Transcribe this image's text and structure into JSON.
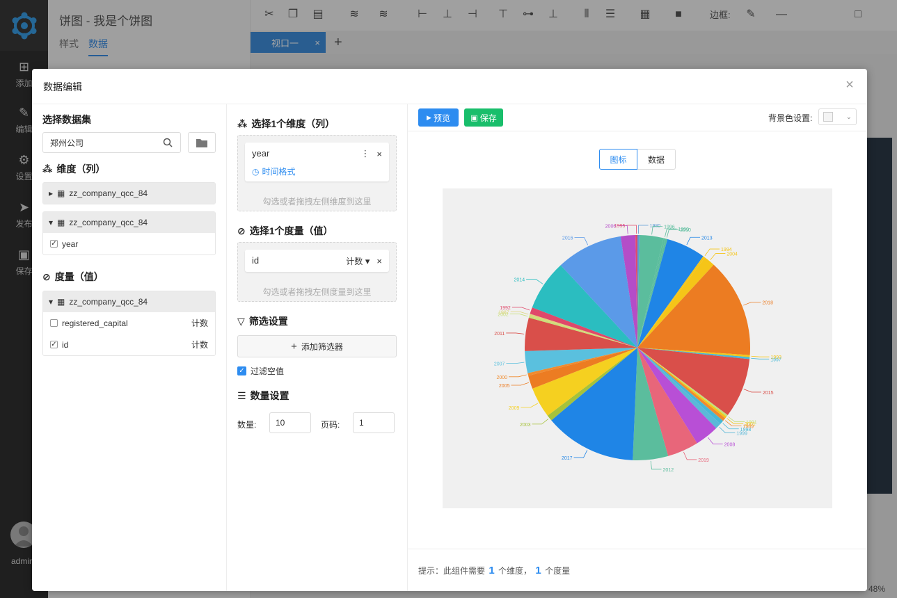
{
  "app": {
    "title": "饼图 - 我是个饼图",
    "side_tabs": [
      "样式",
      "数据"
    ],
    "nav": [
      "添加",
      "编辑",
      "设置",
      "发布",
      "保存"
    ],
    "user": "admin",
    "viewport_tab": "视口一",
    "border_label": "边框:",
    "zoom": "48%"
  },
  "dialog": {
    "title": "数据编辑",
    "dataset": {
      "title": "选择数据集",
      "search_value": "郑州公司",
      "dimensions_title": "维度（列）",
      "dimension_groups": [
        {
          "table": "zz_company_qcc_84",
          "expanded": false,
          "fields": []
        },
        {
          "table": "zz_company_qcc_84",
          "expanded": true,
          "fields": [
            {
              "name": "year",
              "checked": true
            }
          ]
        }
      ],
      "measures_title": "度量（值）",
      "measure_group": {
        "table": "zz_company_qcc_84",
        "fields": [
          {
            "name": "registered_capital",
            "checked": false,
            "agg": "计数"
          },
          {
            "name": "id",
            "checked": true,
            "agg": "计数"
          }
        ]
      }
    },
    "config": {
      "dim_title": "选择1个维度（列）",
      "dim_chip": {
        "name": "year",
        "time_format": "时间格式"
      },
      "dim_hint": "勾选或者拖拽左侧维度到这里",
      "measure_title": "选择1个度量（值）",
      "measure_chip": {
        "name": "id",
        "agg": "计数"
      },
      "measure_hint": "勾选或者拖拽左侧度量到这里",
      "filter_title": "筛选设置",
      "add_filter": "添加筛选器",
      "filter_null": "过滤空值",
      "count_title": "数量设置",
      "count_label": "数量:",
      "count_value": "10",
      "page_label": "页码:",
      "page_value": "1"
    },
    "preview": {
      "preview_btn": "预览",
      "save_btn": "保存",
      "bg_label": "背景色设置:",
      "view_tabs": [
        "图标",
        "数据"
      ],
      "tip": {
        "pre": "提示：此组件需要",
        "n1": "1",
        "mid": "个维度，",
        "n2": "1",
        "post": "个度量"
      }
    }
  },
  "chart_data": {
    "type": "pie",
    "categories": [
      "1980",
      "1996",
      "1990",
      "2010",
      "2013",
      "1994",
      "2004",
      "2018",
      "1993",
      "1997",
      "2015",
      "1991",
      "2001",
      "1989",
      "1998",
      "1999",
      "2008",
      "2019",
      "2012",
      "2017",
      "2003",
      "2009",
      "2005",
      "2000",
      "2007",
      "2011",
      "2002",
      "1987",
      "1992",
      "2014",
      "2016",
      "2006",
      "1995"
    ],
    "values": [
      0.3,
      3.6,
      0.3,
      0.3,
      5.9,
      0.3,
      1.7,
      14.9,
      0.3,
      0.3,
      9.0,
      0.3,
      0.3,
      0.5,
      0.6,
      0.9,
      3.6,
      4.7,
      5.3,
      13.8,
      0.9,
      4.6,
      2.0,
      0.4,
      3.3,
      5.0,
      0.3,
      0.3,
      1.0,
      7.6,
      10.0,
      2.2,
      0.3
    ],
    "colors": [
      "#5b9bd5",
      "#5bbd9d",
      "#5bbd9d",
      "#5bbd9d",
      "#1f85e6",
      "#f5c518",
      "#f5c518",
      "#ec7c22",
      "#f5c518",
      "#47b8d6",
      "#d94f4a",
      "#c4e07a",
      "#f5c518",
      "#f08b2e",
      "#47b8d6",
      "#5bb8d8",
      "#b84fd6",
      "#e8667a",
      "#5bbd9d",
      "#1f85e6",
      "#a6c23a",
      "#f5d020",
      "#ec7c22",
      "#f08b2e",
      "#5ac0de",
      "#d94f4a",
      "#c8e078",
      "#ddd47a",
      "#e0486a",
      "#2bbdc0",
      "#5b9ae8",
      "#b44dc8",
      "#e24a6b"
    ]
  }
}
